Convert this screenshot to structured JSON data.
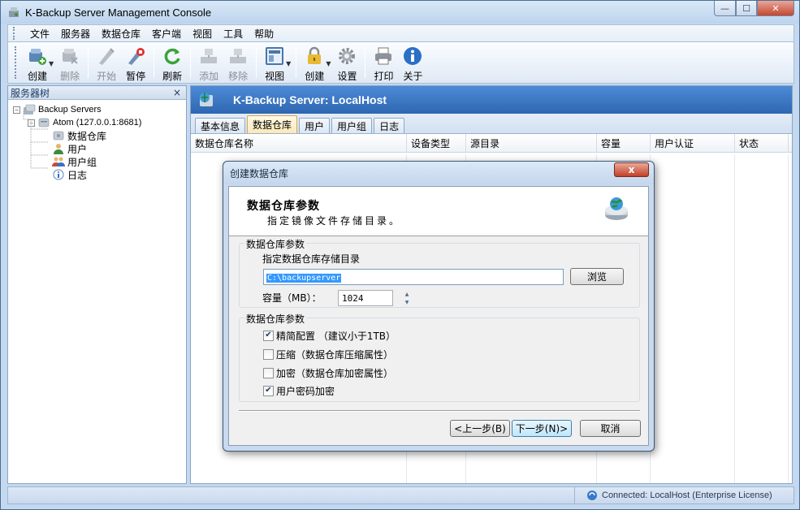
{
  "window": {
    "title": "K-Backup Server Management Console",
    "min": "—",
    "max": "☐",
    "close": "✕"
  },
  "menu": [
    "文件",
    "服务器",
    "数据仓库",
    "客户端",
    "视图",
    "工具",
    "帮助"
  ],
  "toolbar": {
    "create": "创建",
    "delete": "删除",
    "start": "开始",
    "pause": "暂停",
    "refresh": "刷新",
    "add": "添加",
    "remove": "移除",
    "view": "视图",
    "create_lock": "创建",
    "settings": "设置",
    "print": "打印",
    "about": "关于"
  },
  "left_panel": {
    "title": "服务器树",
    "close": "×",
    "tree": {
      "root": "Backup Servers",
      "server": "Atom (127.0.0.1:8681)",
      "children": [
        "数据仓库",
        "用户",
        "用户组",
        "日志"
      ]
    }
  },
  "right_panel": {
    "header": "K-Backup Server: LocalHost",
    "tabs": [
      "基本信息",
      "数据仓库",
      "用户",
      "用户组",
      "日志"
    ],
    "active_tab": "数据仓库",
    "columns": [
      "数据仓库名称",
      "设备类型",
      "源目录",
      "容量",
      "用户认证",
      "状态"
    ]
  },
  "status": {
    "connection": "Connected: LocalHost (Enterprise License)"
  },
  "dialog": {
    "title": "创建数据仓库",
    "close": "x",
    "heading": "数据仓库参数",
    "subheading": "指定镜像文件存储目录。",
    "group1_title": "数据仓库参数",
    "path_label": "指定数据仓库存储目录",
    "path_value": "C:\\backupserver",
    "browse": "浏览",
    "capacity_label": "容量（MB）：",
    "capacity_value": "1024",
    "spin_up": "▲",
    "spin_down": "▼",
    "group2_title": "数据仓库参数",
    "options": [
      {
        "label": "精简配置 （建议小于1TB）",
        "checked": true
      },
      {
        "label": "压缩（数据仓库压缩属性）",
        "checked": false
      },
      {
        "label": "加密（数据仓库加密属性）",
        "checked": false
      },
      {
        "label": "用户密码加密",
        "checked": true
      }
    ],
    "check_mark": "✔",
    "back": "<上一步(B)",
    "next": "下一步(N)>",
    "cancel": "取消"
  }
}
